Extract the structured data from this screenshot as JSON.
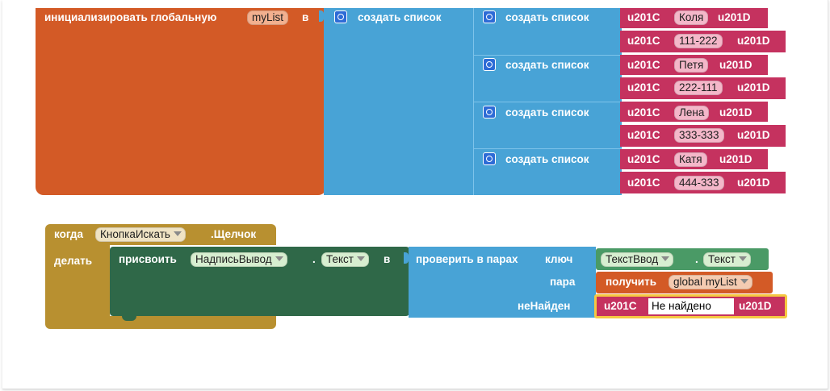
{
  "init_block": {
    "label": "инициализировать глобальную",
    "var_name": "myList",
    "in_label": "в"
  },
  "make_list_label": "создать список",
  "string_quote_open": "u201C",
  "string_quote_close": "u201D",
  "contacts": [
    {
      "name": "Коля",
      "phone": "111-222"
    },
    {
      "name": "Петя",
      "phone": "222-111"
    },
    {
      "name": "Лена",
      "phone": "333-333"
    },
    {
      "name": "Катя",
      "phone": "444-333"
    }
  ],
  "event_block": {
    "when_label": "когда",
    "component": "КнопкаИскать",
    "event": ".Щелчок",
    "do_label": "делать"
  },
  "set_block": {
    "set_label": "присвоить",
    "component": "НадписьВывод",
    "dot": ".",
    "property": "Текст",
    "in_label": "в"
  },
  "lookup_block": {
    "label": "проверить в парах",
    "key_label": "ключ",
    "pairs_label": "пара",
    "notfound_label": "неНайден"
  },
  "key_getter": {
    "component": "ТекстВвод",
    "dot": ".",
    "property": "Текст"
  },
  "get_block": {
    "label": "получить",
    "var": "global myList"
  },
  "notfound_text": "Не найдено",
  "colors": {
    "variables": "#d35a26",
    "lists": "#48a3d6",
    "text": "#c5325f",
    "events": "#b89030",
    "setters": "#2f6848",
    "getters": "#4a9a66",
    "highlight": "#f5c842"
  }
}
